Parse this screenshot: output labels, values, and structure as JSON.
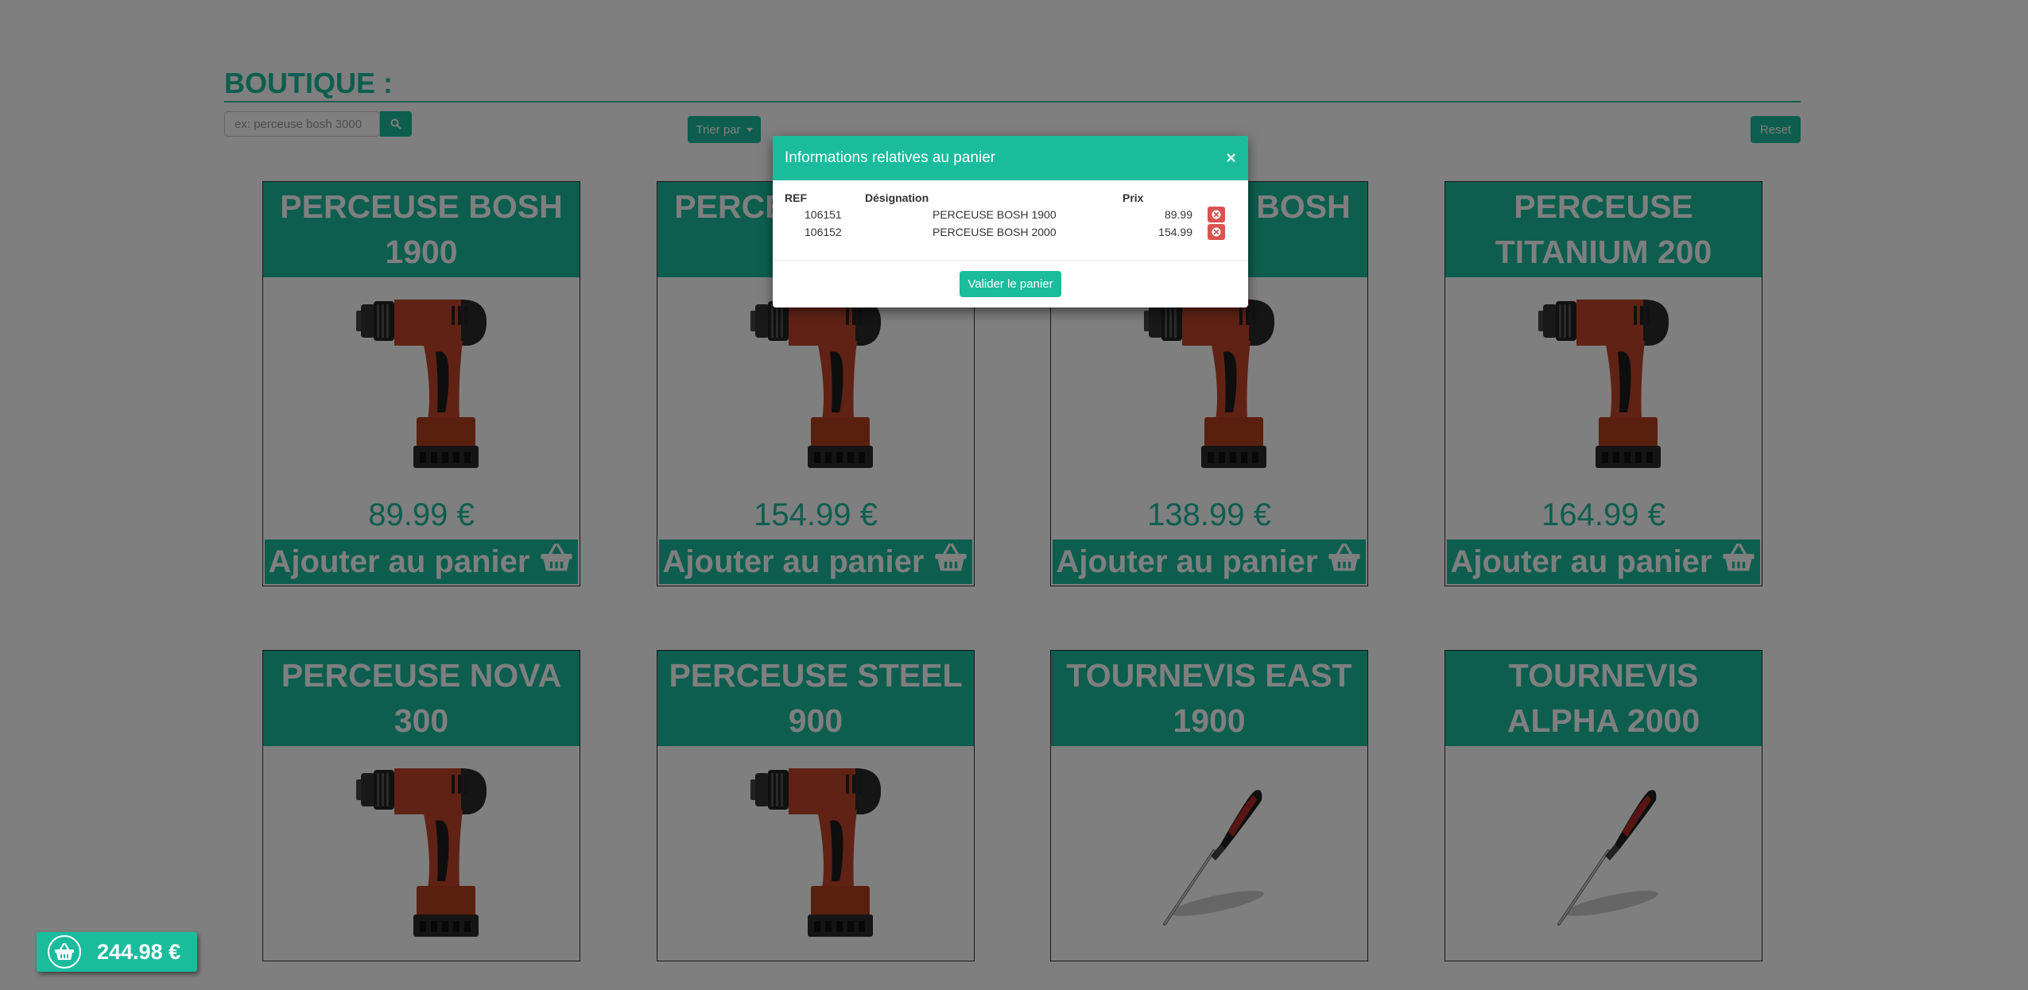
{
  "shop": {
    "title": "BOUTIQUE :",
    "search_placeholder": "ex: perceuse bosh 3000",
    "sort_label": "Trier par",
    "reset_label": "Reset"
  },
  "products": [
    {
      "name": "PERCEUSE BOSH 1900",
      "price": "89.99 €",
      "image": "drill-icon",
      "add_label": "Ajouter au panier"
    },
    {
      "name": "PERCEUSE BOSH 2000",
      "price": "154.99 €",
      "image": "drill-icon",
      "add_label": "Ajouter au panier"
    },
    {
      "name": "PERCEUSE BOSH 2100",
      "price": "138.99 €",
      "image": "drill-icon",
      "add_label": "Ajouter au panier"
    },
    {
      "name": "PERCEUSE TITANIUM 200",
      "price": "164.99 €",
      "image": "drill-icon",
      "add_label": "Ajouter au panier"
    },
    {
      "name": "PERCEUSE NOVA 300",
      "price": "",
      "image": "drill-icon",
      "add_label": ""
    },
    {
      "name": "PERCEUSE STEEL 900",
      "price": "",
      "image": "drill-icon",
      "add_label": ""
    },
    {
      "name": "TOURNEVIS EAST 1900",
      "price": "",
      "image": "screwdriver-icon",
      "add_label": ""
    },
    {
      "name": "TOURNEVIS ALPHA 2000",
      "price": "",
      "image": "screwdriver-icon",
      "add_label": ""
    }
  ],
  "cart_badge": {
    "total": "244.98 €",
    "icon": "basket-icon"
  },
  "modal": {
    "title": "Informations relatives au panier",
    "close_label": "×",
    "columns": {
      "ref": "REF",
      "designation": "Désignation",
      "price": "Prix"
    },
    "rows": [
      {
        "ref": "106151",
        "designation": "PERCEUSE BOSH 1900",
        "price": "89.99"
      },
      {
        "ref": "106152",
        "designation": "PERCEUSE BOSH 2000",
        "price": "154.99"
      }
    ],
    "validate_label": "Valider le panier"
  },
  "colors": {
    "accent": "#1abc9c",
    "danger": "#d9534f",
    "overlay": "rgba(0,0,0,0.5)"
  }
}
